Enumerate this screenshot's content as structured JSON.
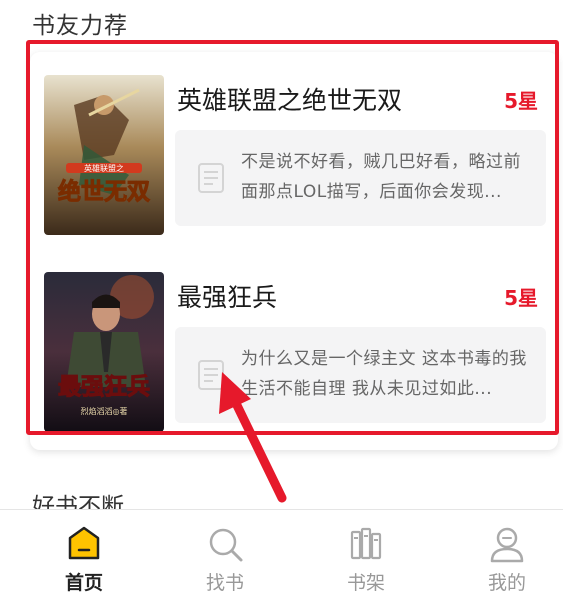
{
  "section": {
    "title": "书友力荐"
  },
  "books": [
    {
      "title": "英雄联盟之绝世无双",
      "rating": "5星",
      "review": "不是说不好看，贼几巴好看，略过前面那点LOL描写，后面你会发现...",
      "cover_text": "绝世无双",
      "cover_top_text": "英雄联盟之"
    },
    {
      "title": "最强狂兵",
      "rating": "5星",
      "review": "为什么又是一个绿主文 这本书毒的我生活不能自理 我从未见过如此...",
      "cover_text": "最强狂兵",
      "cover_author_text": "烈焰滔滔◎著"
    }
  ],
  "next_section": {
    "title": "好书不断"
  },
  "tabbar": {
    "tabs": [
      {
        "label": "首页",
        "icon": "home-icon",
        "active": true
      },
      {
        "label": "找书",
        "icon": "search-icon",
        "active": false
      },
      {
        "label": "书架",
        "icon": "bookshelf-icon",
        "active": false
      },
      {
        "label": "我的",
        "icon": "profile-icon",
        "active": false
      }
    ]
  },
  "colors": {
    "accent": "#ffc300",
    "highlight": "#e6192b",
    "rating": "#e6192b"
  }
}
